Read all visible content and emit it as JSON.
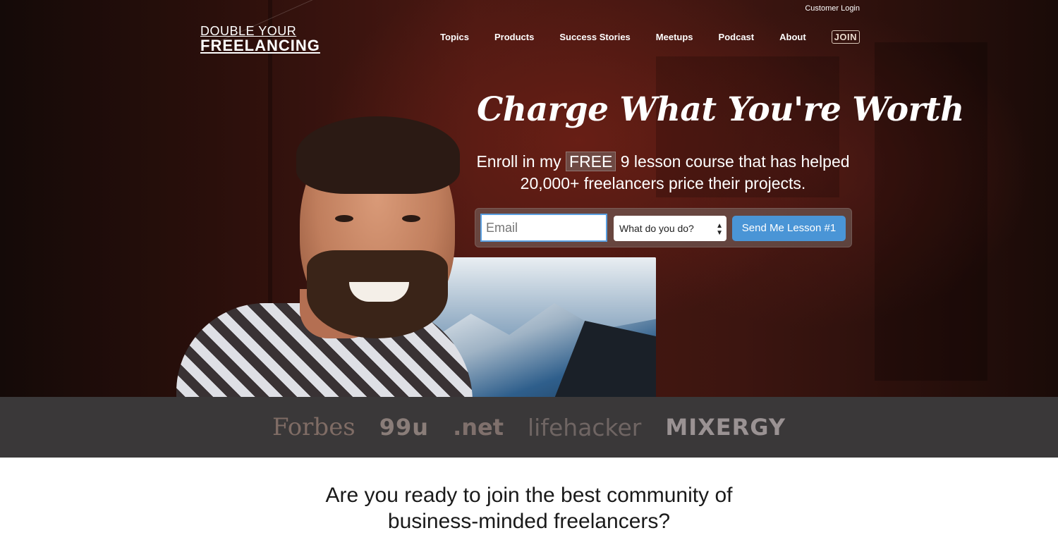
{
  "header": {
    "customer_login": "Customer Login",
    "logo": {
      "line1": "DOUBLE YOUR",
      "line2": "FREELANCING"
    },
    "nav": [
      {
        "label": "Topics"
      },
      {
        "label": "Products"
      },
      {
        "label": "Success Stories"
      },
      {
        "label": "Meetups"
      },
      {
        "label": "Podcast"
      },
      {
        "label": "About"
      }
    ],
    "join_label": "JOIN"
  },
  "hero": {
    "headline": "Charge What You're Worth",
    "subhead": {
      "prefix": "Enroll in my",
      "highlight": "FREE",
      "suffix": "9 lesson course that has helped",
      "line2": "20,000+ freelancers price their projects."
    },
    "form": {
      "email_placeholder": "Email",
      "select_value": "What do you do?",
      "submit_label": "Send Me Lesson #1"
    }
  },
  "press": {
    "logos": [
      "Forbes",
      "99u",
      ".net",
      "lifehacker",
      "MIXERGY"
    ]
  },
  "community": {
    "line1": "Are you ready to join the best community of",
    "line2": "business-minded freelancers?"
  },
  "colors": {
    "accent_button": "#4a95d6",
    "email_border": "#5a9fe0",
    "press_bar": "#3a3839"
  }
}
